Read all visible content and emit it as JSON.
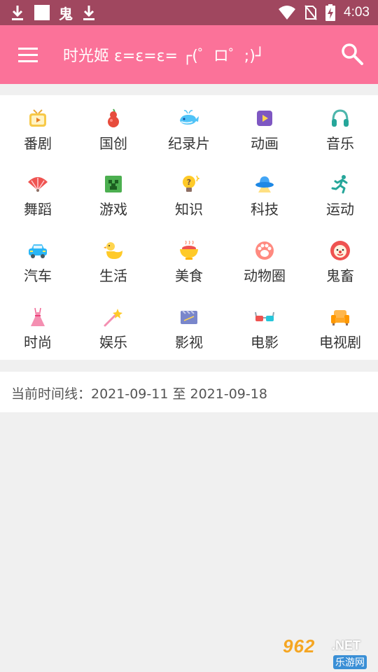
{
  "status_bar": {
    "time": "4:03",
    "left_icons": [
      "download-icon",
      "square-notification-icon",
      "bug-app-icon",
      "download-icon"
    ],
    "right_icons": [
      "wifi-icon",
      "no-sim-icon",
      "battery-charging-icon"
    ],
    "bug_glyph": "鬼"
  },
  "toolbar": {
    "title": "时光姬  ε=ε=ε= ┌(゜ロ゜;)┘",
    "background": "#fb7299"
  },
  "categories": [
    {
      "label": "番剧",
      "icon": "tv-icon"
    },
    {
      "label": "国创",
      "icon": "gourd-icon"
    },
    {
      "label": "纪录片",
      "icon": "whale-icon"
    },
    {
      "label": "动画",
      "icon": "play-box-icon"
    },
    {
      "label": "音乐",
      "icon": "headphones-icon"
    },
    {
      "label": "舞蹈",
      "icon": "fan-icon"
    },
    {
      "label": "游戏",
      "icon": "creeper-icon"
    },
    {
      "label": "知识",
      "icon": "lightbulb-icon"
    },
    {
      "label": "科技",
      "icon": "ufo-icon"
    },
    {
      "label": "运动",
      "icon": "runner-icon"
    },
    {
      "label": "汽车",
      "icon": "car-icon"
    },
    {
      "label": "生活",
      "icon": "duck-icon"
    },
    {
      "label": "美食",
      "icon": "food-bowl-icon"
    },
    {
      "label": "动物圈",
      "icon": "paw-icon"
    },
    {
      "label": "鬼畜",
      "icon": "clown-icon"
    },
    {
      "label": "时尚",
      "icon": "dress-icon"
    },
    {
      "label": "娱乐",
      "icon": "magic-wand-icon"
    },
    {
      "label": "影视",
      "icon": "clapperboard-icon"
    },
    {
      "label": "电影",
      "icon": "3d-glasses-icon"
    },
    {
      "label": "电视剧",
      "icon": "sofa-icon"
    }
  ],
  "timeline": {
    "text": "当前时间线：2021-09-11 至 2021-09-18"
  },
  "watermark": {
    "number": "962",
    "suffix": ".NET",
    "site": "乐游网"
  }
}
